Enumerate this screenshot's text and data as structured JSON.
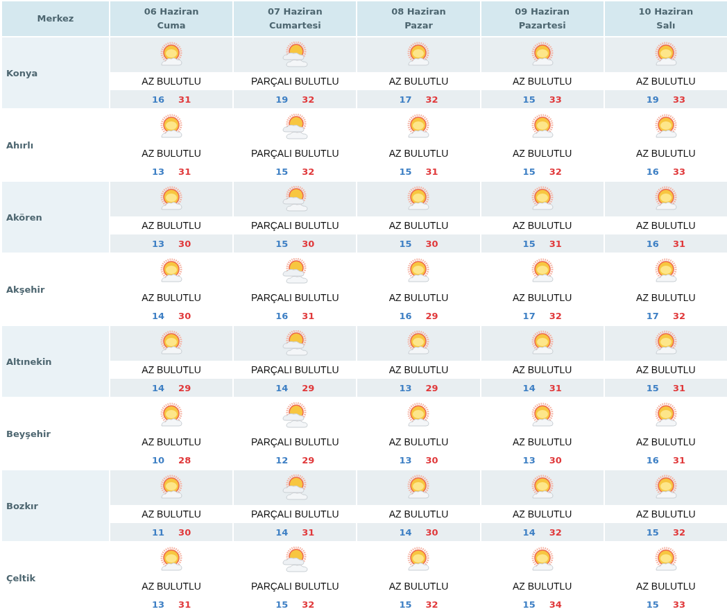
{
  "header": {
    "location_label": "Merkez",
    "days": [
      {
        "date": "06 Haziran",
        "weekday": "Cuma"
      },
      {
        "date": "07 Haziran",
        "weekday": "Cumartesi"
      },
      {
        "date": "08 Haziran",
        "weekday": "Pazar"
      },
      {
        "date": "09 Haziran",
        "weekday": "Pazartesi"
      },
      {
        "date": "10 Haziran",
        "weekday": "Salı"
      }
    ]
  },
  "rows": [
    {
      "city": "Konya",
      "forecasts": [
        {
          "kind": "few",
          "condition": "AZ BULUTLU",
          "min": "16",
          "max": "31"
        },
        {
          "kind": "partly",
          "condition": "PARÇALI BULUTLU",
          "min": "19",
          "max": "32"
        },
        {
          "kind": "few",
          "condition": "AZ BULUTLU",
          "min": "17",
          "max": "32"
        },
        {
          "kind": "few",
          "condition": "AZ BULUTLU",
          "min": "15",
          "max": "33"
        },
        {
          "kind": "few",
          "condition": "AZ BULUTLU",
          "min": "19",
          "max": "33"
        }
      ]
    },
    {
      "city": "Ahırlı",
      "forecasts": [
        {
          "kind": "few",
          "condition": "AZ BULUTLU",
          "min": "13",
          "max": "31"
        },
        {
          "kind": "partly",
          "condition": "PARÇALI BULUTLU",
          "min": "15",
          "max": "32"
        },
        {
          "kind": "few",
          "condition": "AZ BULUTLU",
          "min": "15",
          "max": "31"
        },
        {
          "kind": "few",
          "condition": "AZ BULUTLU",
          "min": "15",
          "max": "32"
        },
        {
          "kind": "few",
          "condition": "AZ BULUTLU",
          "min": "16",
          "max": "33"
        }
      ]
    },
    {
      "city": "Akören",
      "forecasts": [
        {
          "kind": "few",
          "condition": "AZ BULUTLU",
          "min": "13",
          "max": "30"
        },
        {
          "kind": "partly",
          "condition": "PARÇALI BULUTLU",
          "min": "15",
          "max": "30"
        },
        {
          "kind": "few",
          "condition": "AZ BULUTLU",
          "min": "15",
          "max": "30"
        },
        {
          "kind": "few",
          "condition": "AZ BULUTLU",
          "min": "15",
          "max": "31"
        },
        {
          "kind": "few",
          "condition": "AZ BULUTLU",
          "min": "16",
          "max": "31"
        }
      ]
    },
    {
      "city": "Akşehir",
      "forecasts": [
        {
          "kind": "few",
          "condition": "AZ BULUTLU",
          "min": "14",
          "max": "30"
        },
        {
          "kind": "partly",
          "condition": "PARÇALI BULUTLU",
          "min": "16",
          "max": "31"
        },
        {
          "kind": "few",
          "condition": "AZ BULUTLU",
          "min": "16",
          "max": "29"
        },
        {
          "kind": "few",
          "condition": "AZ BULUTLU",
          "min": "17",
          "max": "32"
        },
        {
          "kind": "few",
          "condition": "AZ BULUTLU",
          "min": "17",
          "max": "32"
        }
      ]
    },
    {
      "city": "Altınekin",
      "forecasts": [
        {
          "kind": "few",
          "condition": "AZ BULUTLU",
          "min": "14",
          "max": "29"
        },
        {
          "kind": "partly",
          "condition": "PARÇALI BULUTLU",
          "min": "14",
          "max": "29"
        },
        {
          "kind": "few",
          "condition": "AZ BULUTLU",
          "min": "13",
          "max": "29"
        },
        {
          "kind": "few",
          "condition": "AZ BULUTLU",
          "min": "14",
          "max": "31"
        },
        {
          "kind": "few",
          "condition": "AZ BULUTLU",
          "min": "15",
          "max": "31"
        }
      ]
    },
    {
      "city": "Beyşehir",
      "forecasts": [
        {
          "kind": "few",
          "condition": "AZ BULUTLU",
          "min": "10",
          "max": "28"
        },
        {
          "kind": "partly",
          "condition": "PARÇALI BULUTLU",
          "min": "12",
          "max": "29"
        },
        {
          "kind": "few",
          "condition": "AZ BULUTLU",
          "min": "13",
          "max": "30"
        },
        {
          "kind": "few",
          "condition": "AZ BULUTLU",
          "min": "13",
          "max": "30"
        },
        {
          "kind": "few",
          "condition": "AZ BULUTLU",
          "min": "16",
          "max": "31"
        }
      ]
    },
    {
      "city": "Bozkır",
      "forecasts": [
        {
          "kind": "few",
          "condition": "AZ BULUTLU",
          "min": "11",
          "max": "30"
        },
        {
          "kind": "partly",
          "condition": "PARÇALI BULUTLU",
          "min": "14",
          "max": "31"
        },
        {
          "kind": "few",
          "condition": "AZ BULUTLU",
          "min": "14",
          "max": "30"
        },
        {
          "kind": "few",
          "condition": "AZ BULUTLU",
          "min": "14",
          "max": "32"
        },
        {
          "kind": "few",
          "condition": "AZ BULUTLU",
          "min": "15",
          "max": "32"
        }
      ]
    },
    {
      "city": "Çeltik",
      "forecasts": [
        {
          "kind": "few",
          "condition": "AZ BULUTLU",
          "min": "13",
          "max": "31"
        },
        {
          "kind": "partly",
          "condition": "PARÇALI BULUTLU",
          "min": "15",
          "max": "32"
        },
        {
          "kind": "few",
          "condition": "AZ BULUTLU",
          "min": "15",
          "max": "32"
        },
        {
          "kind": "few",
          "condition": "AZ BULUTLU",
          "min": "15",
          "max": "34"
        },
        {
          "kind": "few",
          "condition": "AZ BULUTLU",
          "min": "15",
          "max": "33"
        }
      ]
    }
  ]
}
